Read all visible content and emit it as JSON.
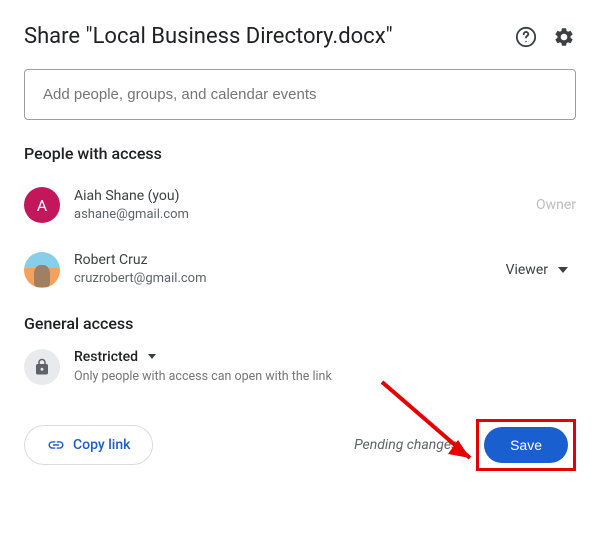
{
  "header": {
    "title": "Share \"Local Business Directory.docx\""
  },
  "input": {
    "placeholder": "Add people, groups, and calendar events"
  },
  "sections": {
    "people_title": "People with access",
    "general_title": "General access"
  },
  "people": [
    {
      "initial": "A",
      "name": "Aiah Shane (you)",
      "email": "ashane@gmail.com",
      "role": "Owner"
    },
    {
      "name": "Robert Cruz",
      "email": "cruzrobert@gmail.com",
      "role": "Viewer"
    }
  ],
  "general": {
    "mode": "Restricted",
    "description": "Only people with access can open with the link"
  },
  "footer": {
    "copy_link": "Copy link",
    "pending": "Pending changes",
    "save": "Save"
  }
}
